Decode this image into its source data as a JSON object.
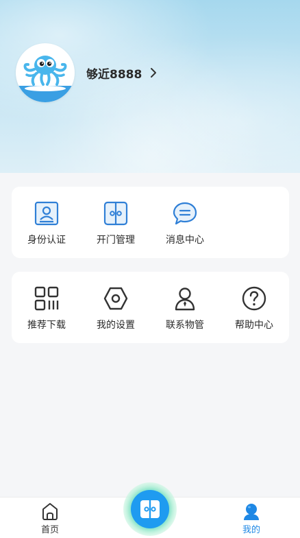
{
  "profile": {
    "username": "够近8888",
    "avatar_icon": "octopus-avatar-icon",
    "chevron_icon": "chevron-right-icon"
  },
  "card1": {
    "items": [
      {
        "label": "身份认证",
        "icon": "id-card-icon"
      },
      {
        "label": "开门管理",
        "icon": "door-icon"
      },
      {
        "label": "消息中心",
        "icon": "chat-bubble-icon"
      }
    ]
  },
  "card2": {
    "items": [
      {
        "label": "推荐下载",
        "icon": "qr-code-icon"
      },
      {
        "label": "我的设置",
        "icon": "settings-hex-icon"
      },
      {
        "label": "联系物管",
        "icon": "manager-person-icon"
      },
      {
        "label": "帮助中心",
        "icon": "help-circle-icon"
      }
    ]
  },
  "tabbar": {
    "home_label": "首页",
    "mine_label": "我的",
    "center_icon": "door-open-icon"
  },
  "colors": {
    "accent": "#1e88e5",
    "icon_blue": "#2f7fd6",
    "header_sky": "#a6d8ee"
  }
}
